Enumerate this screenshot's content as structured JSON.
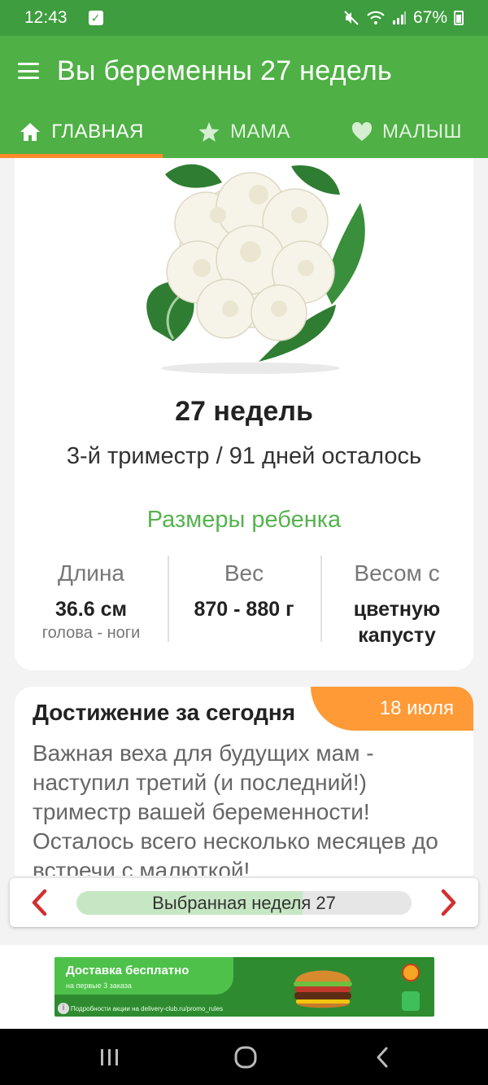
{
  "status_bar": {
    "time": "12:43",
    "battery": "67%"
  },
  "app_bar": {
    "title": "Вы беременны 27 недель",
    "tabs": [
      {
        "label": "ГЛАВНАЯ",
        "icon": "home-icon",
        "active": true
      },
      {
        "label": "МАМА",
        "icon": "star-icon",
        "active": false
      },
      {
        "label": "МАЛЫШ",
        "icon": "heart-icon",
        "active": false
      }
    ]
  },
  "main": {
    "image": "cauliflower-image",
    "week_title": "27 недель",
    "week_subtitle": "3-й триместр / 91 дней осталось",
    "sizes_title": "Размеры ребенка",
    "stats": {
      "length": {
        "label": "Длина",
        "value": "36.6 см",
        "note": "голова - ноги"
      },
      "weight": {
        "label": "Вес",
        "value": "870 - 880 г"
      },
      "compare": {
        "label": "Весом с",
        "value_line1": "цветную",
        "value_line2": "капусту"
      }
    }
  },
  "achievement": {
    "title": "Достижение за сегодня",
    "date": "18 июля",
    "text": "Важная веха для будущих мам - наступил третий (и последний!) триместр вашей беременности! Осталось всего несколько месяцев до встречи с малюткой!"
  },
  "week_selector": {
    "label": "Выбранная неделя 27",
    "progress_fraction": 0.675
  },
  "ad": {
    "headline": "Доставка бесплатно",
    "subline": "на первые 3 заказа",
    "footer": "Подробности акции на delivery-club.ru/promo_rules"
  },
  "colors": {
    "status_bar": "#3e9d3e",
    "app_bar": "#4fb045",
    "accent_orange": "#ff8a28",
    "accent_green_text": "#55b34e",
    "arrow_red": "#d32f2f"
  }
}
